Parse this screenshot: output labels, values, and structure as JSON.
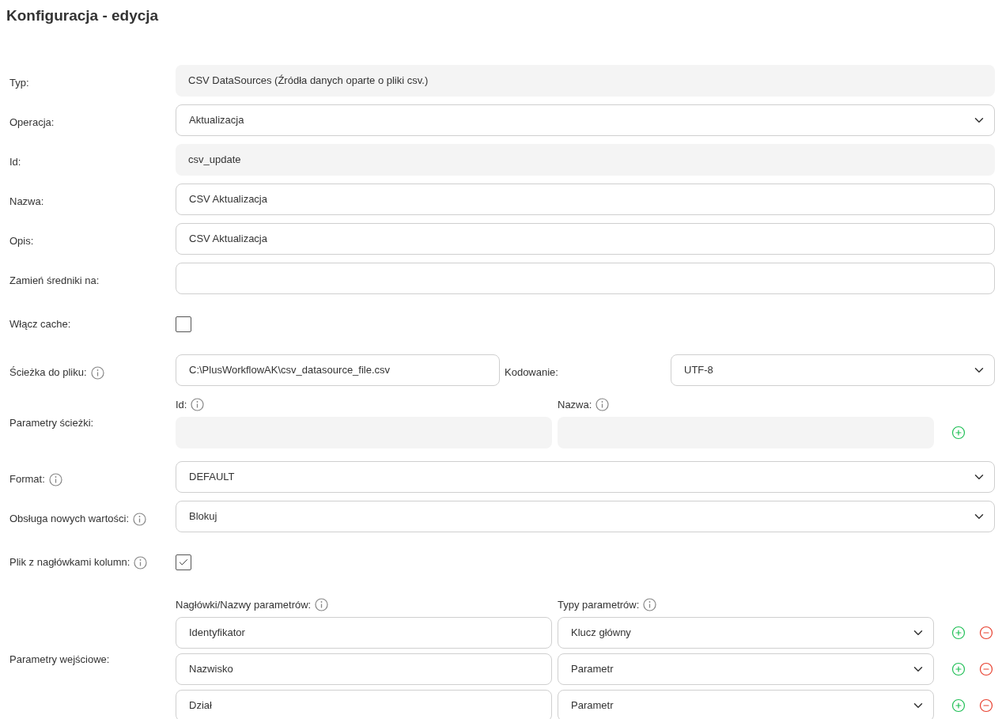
{
  "title": "Konfiguracja - edycja",
  "fields": [
    {
      "kind": "readonly",
      "label": "Typ:",
      "info": false,
      "value": "CSV DataSources (Źródła danych oparte o pliki csv.)"
    },
    {
      "kind": "select",
      "label": "Operacja:",
      "info": false,
      "value": "Aktualizacja"
    },
    {
      "kind": "readonly",
      "label": "Id:",
      "info": false,
      "value": "csv_update"
    },
    {
      "kind": "input",
      "label": "Nazwa:",
      "info": false,
      "value": "CSV Aktualizacja"
    },
    {
      "kind": "input",
      "label": "Opis:",
      "info": false,
      "value": "CSV Aktualizacja"
    },
    {
      "kind": "input",
      "label": "Zamień średniki na:",
      "info": false
    },
    {
      "kind": "checkbox",
      "label": "Włącz cache:",
      "info": false,
      "checked": false
    },
    {
      "kind": "file",
      "label": "Ścieżka do pliku:",
      "info": true,
      "value": "C:\\PlusWorkflowAK\\csv_datasource_file.csv",
      "encoding": {
        "label": "Kodowanie:",
        "value": "UTF-8"
      }
    },
    {
      "kind": "path_params",
      "label": "Parametry ścieżki:",
      "info": false,
      "columns": [
        {
          "label": "Id:",
          "info": true
        },
        {
          "label": "Nazwa:",
          "info": true
        }
      ]
    },
    {
      "kind": "select",
      "label": "Format:",
      "info": true,
      "value": "DEFAULT"
    },
    {
      "kind": "select",
      "label": "Obsługa nowych wartości:",
      "info": true,
      "value": "Blokuj"
    },
    {
      "kind": "checkbox",
      "label": "Plik z nagłówkami kolumn:",
      "info": true,
      "checked": true
    },
    {
      "kind": "param_table",
      "label": "Parametry wejściowe:",
      "info": false,
      "columns": [
        {
          "label": "Nagłówki/Nazwy parametrów:",
          "info": true
        },
        {
          "label": "Typy parametrów:",
          "info": true
        }
      ],
      "rows": [
        {
          "name": "Identyfikator",
          "type": "Klucz główny"
        },
        {
          "name": "Nazwisko",
          "type": "Parametr"
        },
        {
          "name": "Dział",
          "type": "Parametr"
        }
      ]
    }
  ]
}
